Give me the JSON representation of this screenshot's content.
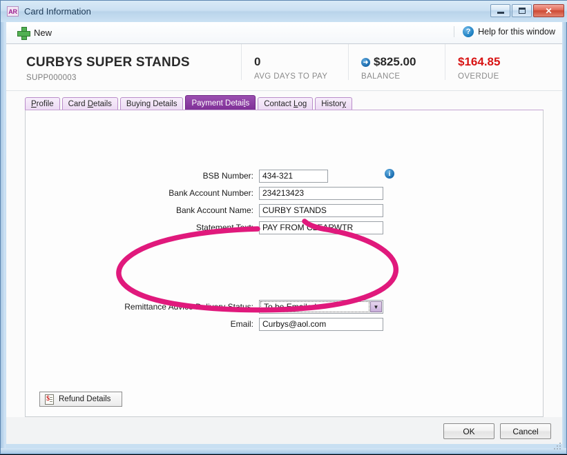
{
  "window": {
    "app_badge": "AR",
    "title": "Card Information",
    "controls": {
      "minimize": "minimize-icon",
      "maximize": "maximize-icon",
      "close": "✕"
    }
  },
  "toolbar": {
    "new_label": "New",
    "new_icon": "plus-icon",
    "help_label": "Help for this window",
    "help_icon": "question-mark-icon"
  },
  "header": {
    "company_name": "CURBYS SUPER STANDS",
    "company_code": "SUPP000003",
    "stats": [
      {
        "value": "0",
        "label": "AVG DAYS TO PAY"
      },
      {
        "value": "$825.00",
        "label": "BALANCE",
        "icon": "arrow-right-circle-icon"
      },
      {
        "value": "$164.85",
        "label": "OVERDUE",
        "color": "#d81414"
      }
    ]
  },
  "tabs": [
    {
      "label": "Profile",
      "accel": "P",
      "active": false
    },
    {
      "label": "Card Details",
      "accel": "D",
      "active": false
    },
    {
      "label": "Buying Details",
      "accel": "g",
      "active": false
    },
    {
      "label": "Payment Details",
      "accel": "l",
      "active": true
    },
    {
      "label": "Contact Log",
      "accel": "L",
      "active": false
    },
    {
      "label": "History",
      "accel": "y",
      "active": false
    }
  ],
  "form": {
    "bsb_label": "BSB Number:",
    "bsb_value": "434-321",
    "account_number_label": "Bank Account Number:",
    "account_number_value": "234213423",
    "account_name_label": "Bank Account Name:",
    "account_name_value": "CURBY STANDS",
    "statement_text_label": "Statement Text:",
    "statement_text_value": "PAY FROM CLEARWTR",
    "info_icon": "info-icon",
    "remittance_label": "Remittance Advice Delivery Status:",
    "remittance_value": "To be Emailed",
    "remittance_dropdown_icon": "chevron-down-icon",
    "email_label": "Email:",
    "email_value": "Curbys@aol.com"
  },
  "refund": {
    "label": "Refund Details",
    "icon": "invoice-dollar-icon"
  },
  "footer": {
    "ok_label": "OK",
    "cancel_label": "Cancel"
  },
  "annotation": {
    "color": "#e0197c",
    "shape": "hand-drawn-ellipse"
  }
}
